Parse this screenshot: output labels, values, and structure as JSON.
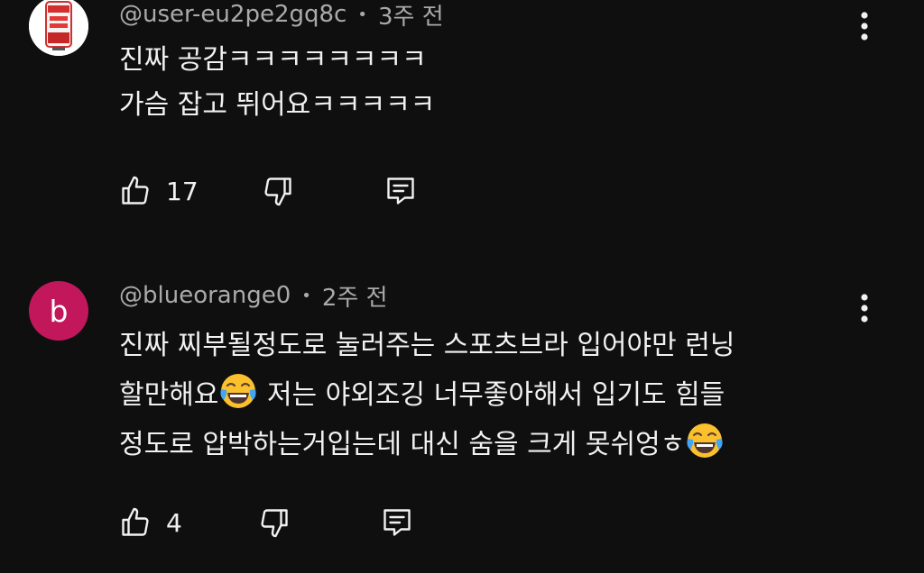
{
  "comments": [
    {
      "handle": "@user-eu2pe2gq8c",
      "time": "3주 전",
      "avatar": {
        "type": "image",
        "icon": "drink-can-icon"
      },
      "lines": [
        "진짜 공감ㅋㅋㅋㅋㅋㅋㅋㅋ",
        "가슴 잡고 뛰어요ㅋㅋㅋㅋㅋ"
      ],
      "likes": "17"
    },
    {
      "handle": "@blueorange0",
      "time": "2주 전",
      "avatar": {
        "type": "letter",
        "letter": "b",
        "color": "#c2185b"
      },
      "lines": [
        "진짜 찌부될정도로 눌러주는 스포츠브라 입어야만 런닝",
        "할만해요",
        " 저는 야외조깅 너무좋아해서 입기도 힘들",
        "정도로 압박하는거입는데 대신 숨을 크게 못쉬엉ㅎ"
      ],
      "likes": "4"
    }
  ],
  "icons": {
    "like": "thumbs-up-icon",
    "dislike": "thumbs-down-icon",
    "reply": "reply-comment-icon",
    "more": "more-vertical-icon",
    "emoji": "tears-of-joy-emoji"
  }
}
